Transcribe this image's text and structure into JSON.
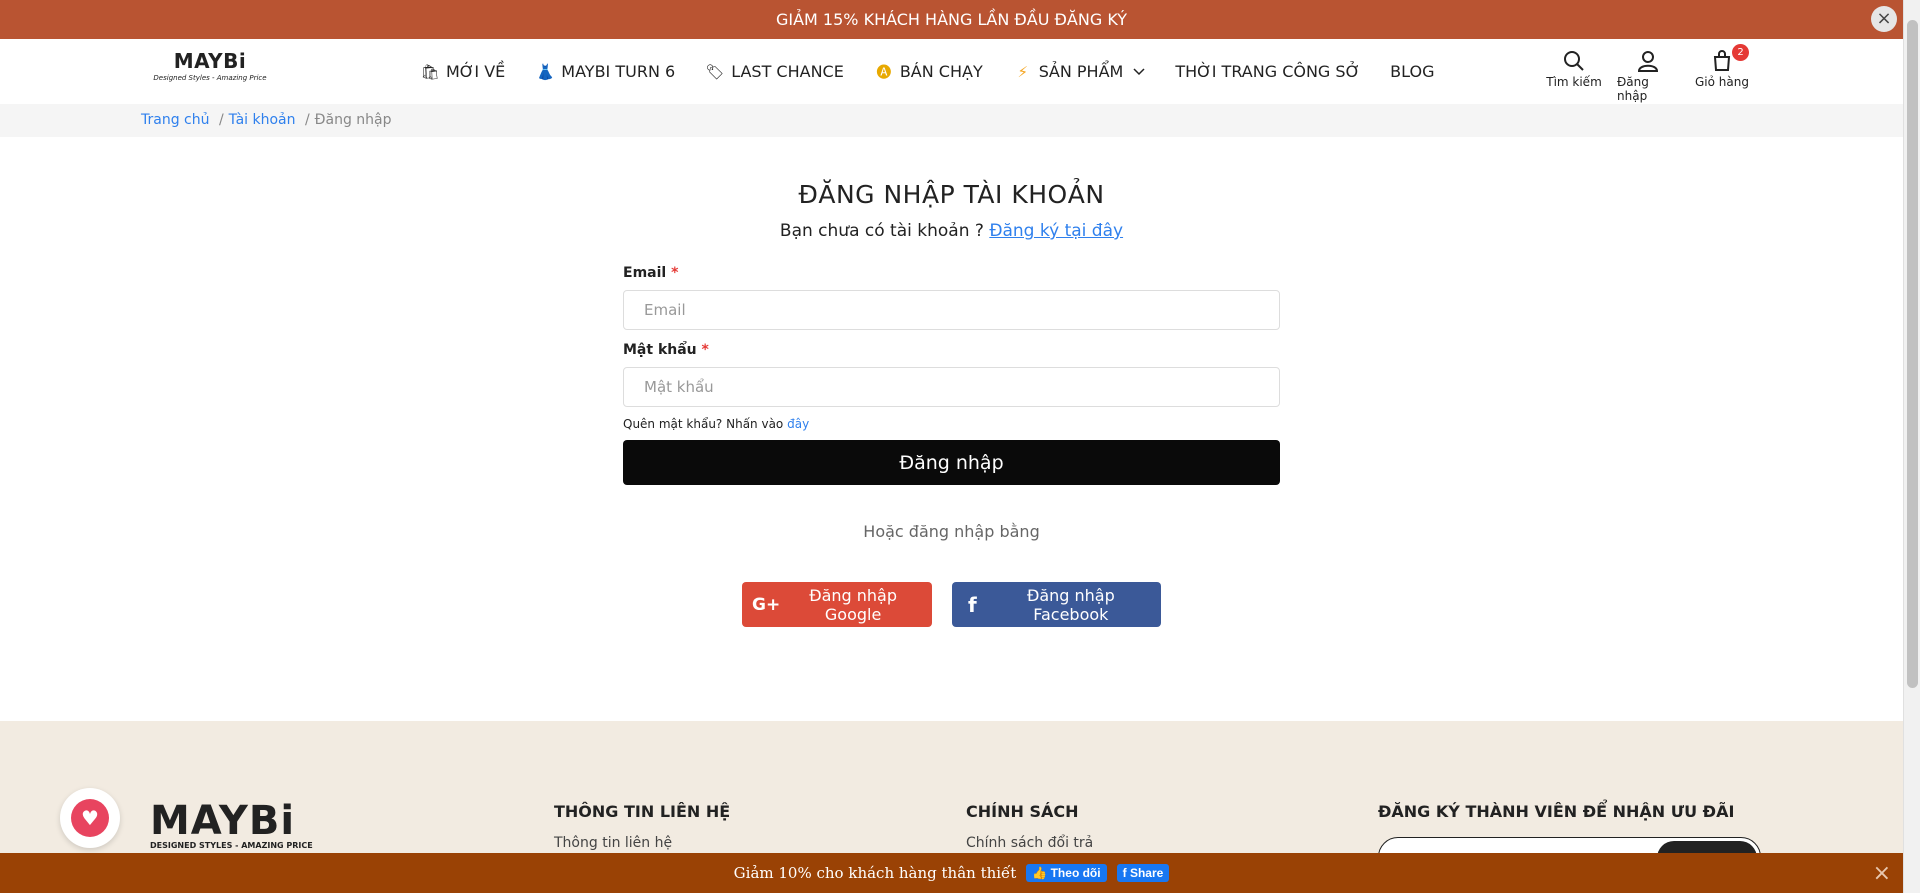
{
  "top_banner": {
    "text": "GIẢM 15% KHÁCH HÀNG LẦN ĐẦU ĐĂNG KÝ",
    "close": "×"
  },
  "logo": {
    "brand": "MAYBi",
    "tagline": "Designed Styles - Amazing Price"
  },
  "nav": {
    "items": [
      {
        "label": "MỚI VỀ",
        "icon": "new-arrival-icon",
        "glyph": "🛍"
      },
      {
        "label": "MAYBI TURN 6",
        "icon": "dress-icon",
        "glyph": "👗"
      },
      {
        "label": "LAST CHANCE",
        "icon": "tag-icon",
        "glyph": "🏷"
      },
      {
        "label": "BÁN CHẠY",
        "icon": "hot-badge-icon",
        "glyph": "🅐"
      },
      {
        "label": "SẢN PHẨM",
        "icon": "lightning-icon",
        "glyph": "⚡",
        "has_dropdown": true
      },
      {
        "label": "THỜI TRANG CÔNG SỞ"
      },
      {
        "label": "BLOG"
      }
    ],
    "search_label": "Tìm kiếm",
    "login_label": "Đăng nhập",
    "cart_label": "Giỏ hàng",
    "cart_count": "2"
  },
  "breadcrumb": {
    "home": "Trang chủ",
    "account": "Tài khoản",
    "current": "Đăng nhập",
    "sep": "/"
  },
  "login": {
    "title": "ĐĂNG NHẬP TÀI KHOẢN",
    "no_account": "Bạn chưa có tài khoản ?",
    "register_link": "Đăng ký tại đây",
    "email_label": "Email",
    "email_placeholder": "Email",
    "password_label": "Mật khẩu",
    "password_placeholder": "Mật khẩu",
    "required_mark": "*",
    "forgot_text": "Quên mật khẩu? Nhấn vào",
    "forgot_link": "đây",
    "submit": "Đăng nhập",
    "or_text": "Hoặc đăng nhập bằng",
    "google_label": "Đăng nhập Google",
    "facebook_label": "Đăng nhập Facebook"
  },
  "footer": {
    "brand": "MAYBi",
    "tagline": "DESIGNED STYLES - AMAZING PRICE",
    "contact_heading": "THÔNG TIN LIÊN HỆ",
    "contact_link": "Thông tin liên hệ",
    "policy_heading": "CHÍNH SÁCH",
    "policy_link": "Chính sách đổi trả",
    "signup_heading": "ĐĂNG KÝ THÀNH VIÊN ĐỂ NHẬN ƯU ĐÃI"
  },
  "bottom_bar": {
    "text": "Giảm 10% cho khách hàng thân thiết",
    "follow": "👍 Theo dõi",
    "share": "Share",
    "close": "×"
  },
  "colors": {
    "top_banner": "#b95432",
    "bottom_bar": "#9a4205",
    "link": "#2f80ed",
    "google": "#dc4a38",
    "facebook": "#3b5998",
    "footer_bg": "#f2ebe1"
  }
}
